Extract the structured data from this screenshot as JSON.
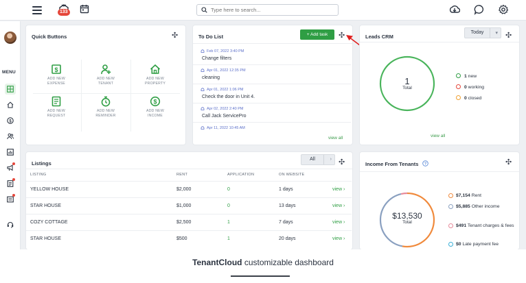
{
  "topbar": {
    "badge_count": "133",
    "search_placeholder": "Type here to search..."
  },
  "sidebar": {
    "menu_label": "MENU"
  },
  "quick_buttons": {
    "title": "Quick Buttons",
    "items": [
      {
        "line1": "ADD NEW",
        "line2": "EXPENSE",
        "icon": "dollar-doc-icon"
      },
      {
        "line1": "ADD NEW",
        "line2": "TENANT",
        "icon": "add-user-icon"
      },
      {
        "line1": "ADD NEW",
        "line2": "PROPERTY",
        "icon": "house-icon"
      },
      {
        "line1": "ADD NEW",
        "line2": "REQUEST",
        "icon": "request-doc-icon"
      },
      {
        "line1": "ADD NEW",
        "line2": "REMINDER",
        "icon": "stopwatch-icon"
      },
      {
        "line1": "ADD NEW",
        "line2": "INCOME",
        "icon": "dollar-circle-icon"
      }
    ]
  },
  "todo": {
    "title": "To Do List",
    "add_label": "+ Add task",
    "view_all": "view all",
    "items": [
      {
        "date": "Feb 07, 2022 3:40 PM",
        "text": "Change filters"
      },
      {
        "date": "Apr 01, 2022 12:35 PM",
        "text": "cleaning"
      },
      {
        "date": "Apr 01, 2022 1:06 PM",
        "text": "Check the door in Unit 4."
      },
      {
        "date": "Apr 02, 2022 2:40 PM",
        "text": "Call Jack ServicePro"
      },
      {
        "date": "Apr 11, 2022 10:45 AM",
        "text": ""
      }
    ]
  },
  "leads": {
    "title": "Leads CRM",
    "period": "Today",
    "total_value": "1",
    "total_label": "Total",
    "view_all": "view all",
    "legend": [
      {
        "count": "1",
        "label": "new",
        "color": "#2f9e44"
      },
      {
        "count": "0",
        "label": "working",
        "color": "#e5463a"
      },
      {
        "count": "0",
        "label": "closed",
        "color": "#f0a030"
      }
    ]
  },
  "listings": {
    "title": "Listings",
    "filter": "All",
    "columns": [
      "LISTING",
      "RENT",
      "APPLICATION",
      "ON WEBSITE"
    ],
    "rows": [
      {
        "name": "YELLOW HOUSE",
        "rent": "$2,000",
        "apps": "0",
        "days": "1 days"
      },
      {
        "name": "STAR HOUSE",
        "rent": "$1,000",
        "apps": "0",
        "days": "13 days"
      },
      {
        "name": "COZY COTTAGE",
        "rent": "$2,500",
        "apps": "1",
        "days": "7 days"
      },
      {
        "name": "STAR HOUSE",
        "rent": "$500",
        "apps": "1",
        "days": "20 days"
      }
    ],
    "view_label": "view ›"
  },
  "income": {
    "title": "Income From Tenants",
    "total_value": "$13,530",
    "total_label": "Total",
    "items": [
      {
        "amount": "$7,154",
        "label": "Rent",
        "color": "#f08a3c"
      },
      {
        "amount": "$5,885",
        "label": "Other income",
        "color": "#8aa0c0"
      },
      {
        "amount": "$491",
        "label": "Tenant charges & fees",
        "color": "#e88a9a"
      },
      {
        "amount": "$0",
        "label": "Late payment fee",
        "color": "#3ab0d8"
      }
    ]
  },
  "caption": {
    "brand": "TenantCloud",
    "rest": " customizable dashboard"
  }
}
